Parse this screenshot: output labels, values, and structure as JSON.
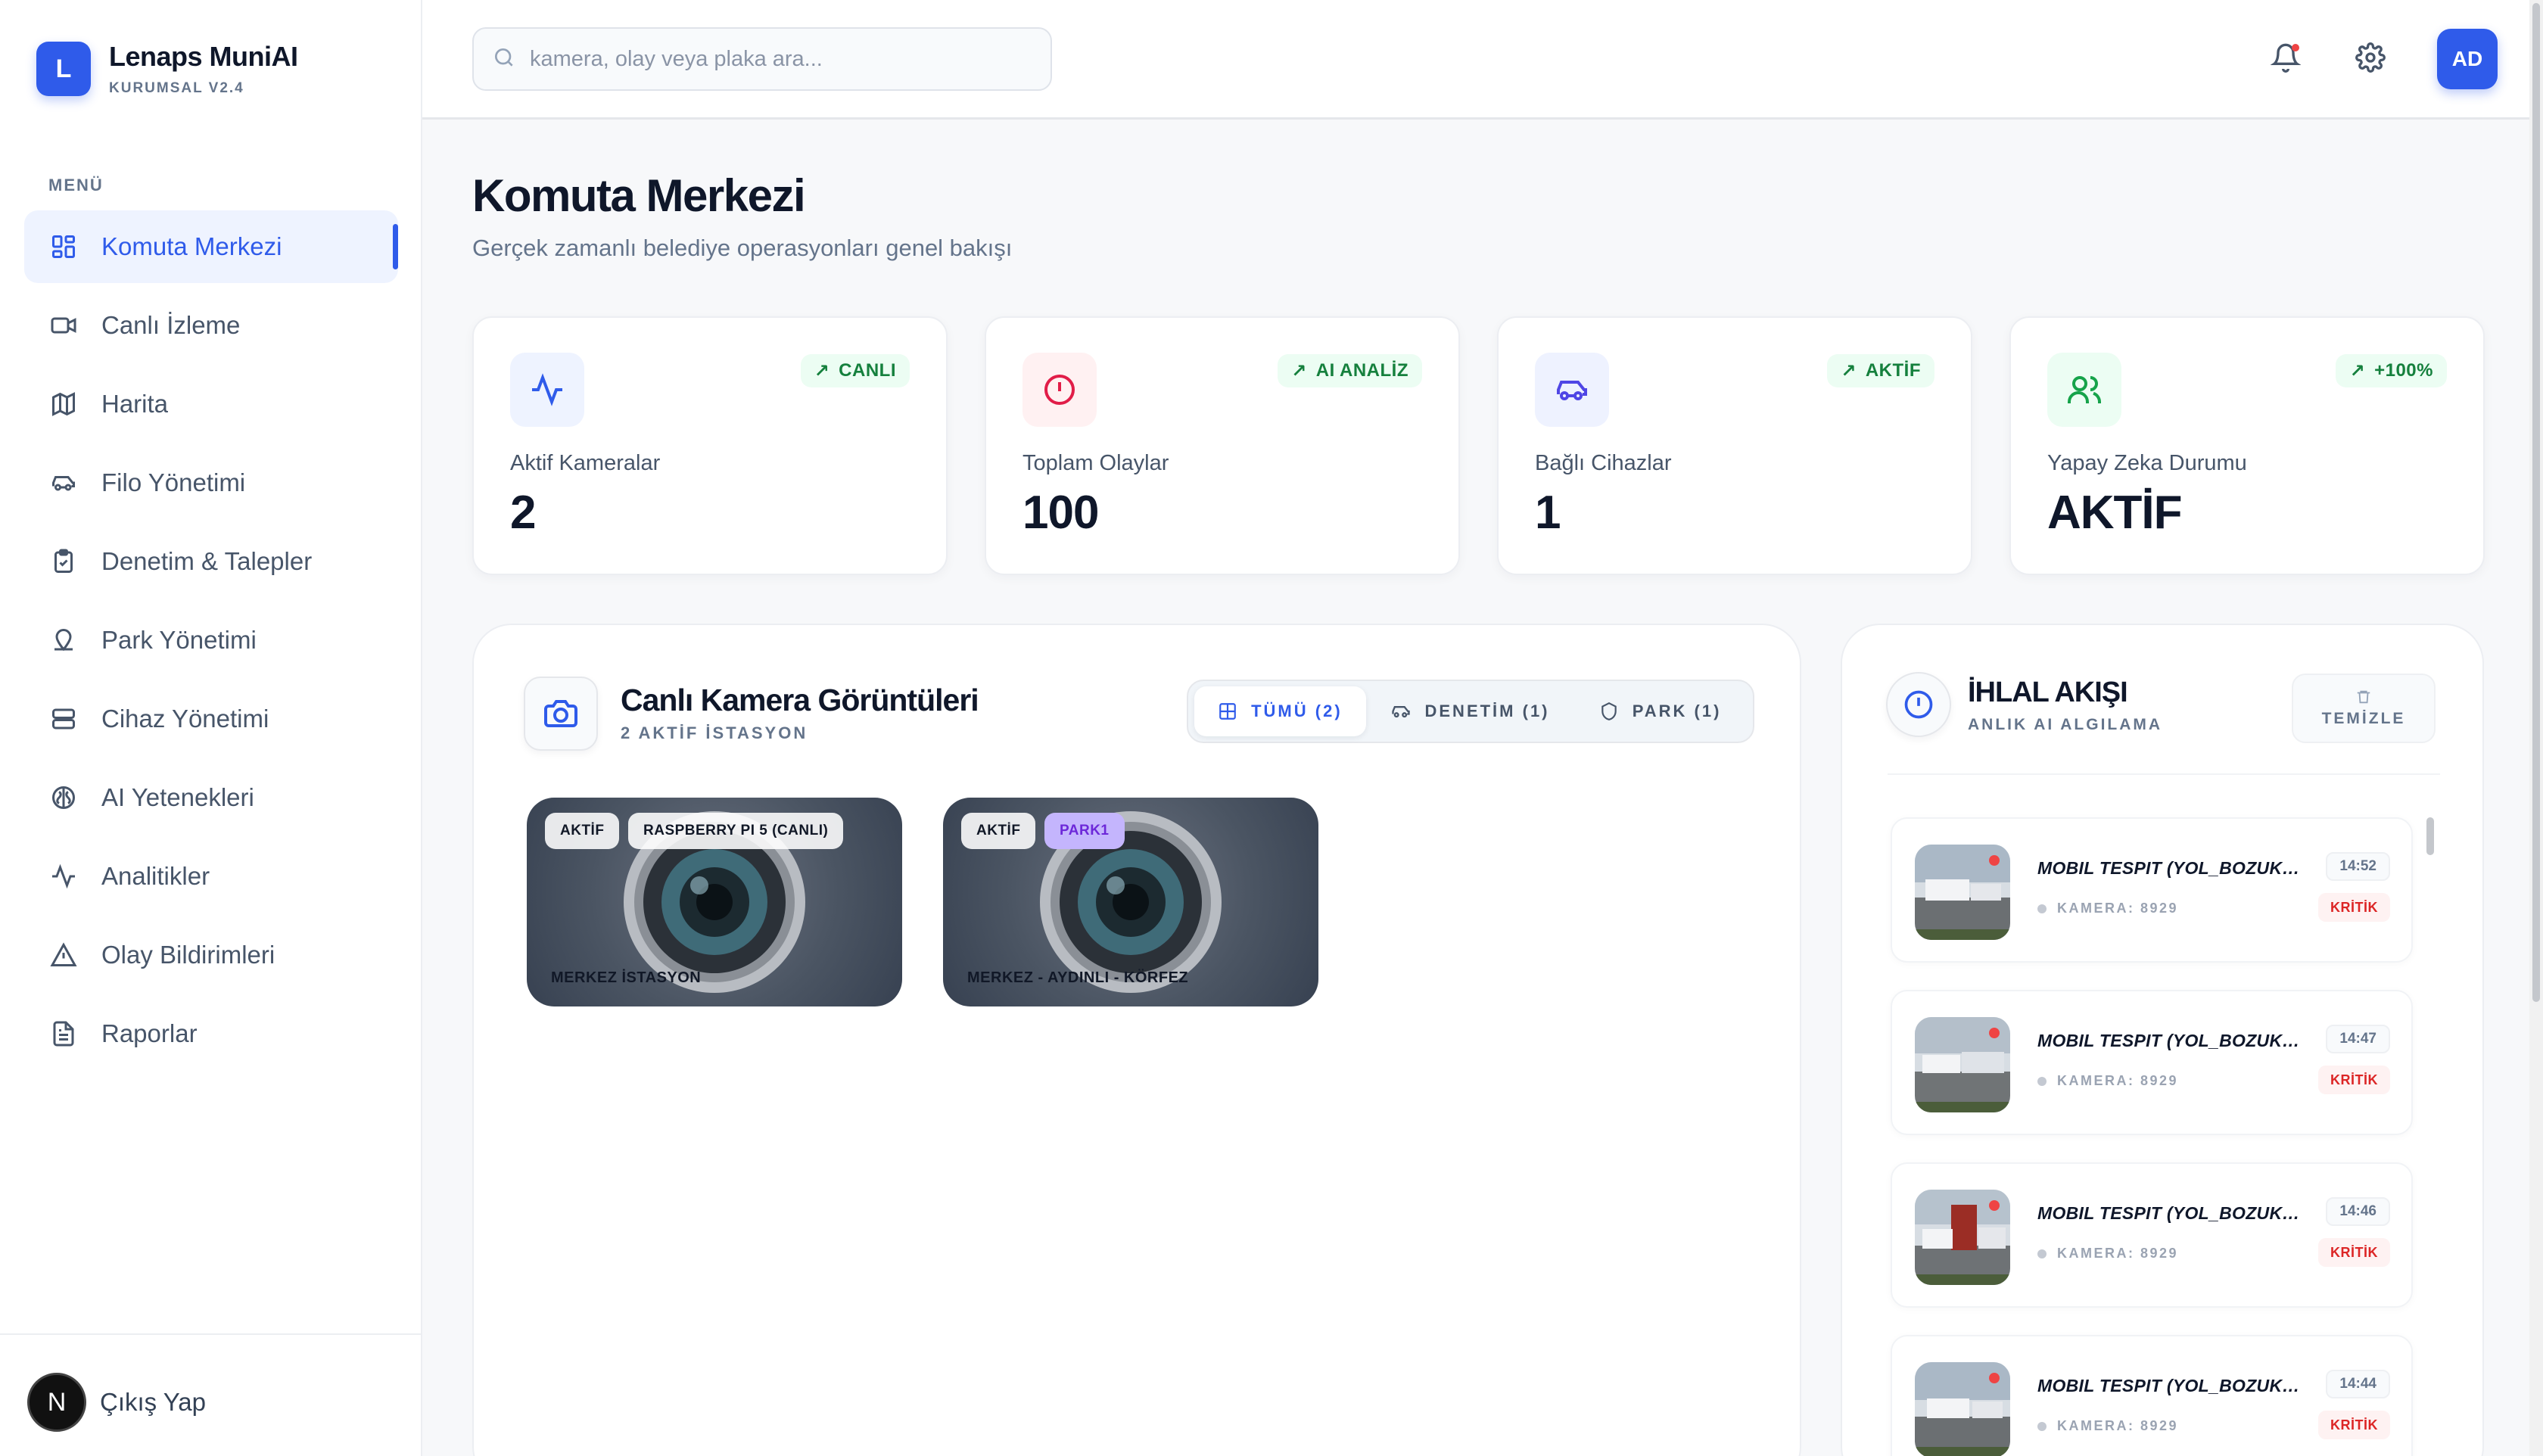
{
  "brand": {
    "logo_letter": "L",
    "name": "Lenaps MuniAI",
    "subtitle": "KURUMSAL V2.4",
    "accent_color": "#2f5bea"
  },
  "sidebar": {
    "menu_heading": "MENÜ",
    "items": [
      {
        "label": "Komuta Merkezi",
        "icon": "dashboard-grid-icon",
        "active": true
      },
      {
        "label": "Canlı İzleme",
        "icon": "video-camera-icon"
      },
      {
        "label": "Harita",
        "icon": "map-icon"
      },
      {
        "label": "Filo Yönetimi",
        "icon": "car-icon"
      },
      {
        "label": "Denetim & Talepler",
        "icon": "clipboard-check-icon"
      },
      {
        "label": "Park Yönetimi",
        "icon": "parking-icon"
      },
      {
        "label": "Cihaz Yönetimi",
        "icon": "server-icon"
      },
      {
        "label": "AI Yetenekleri",
        "icon": "brain-icon"
      },
      {
        "label": "Analitikler",
        "icon": "activity-icon"
      },
      {
        "label": "Olay Bildirimleri",
        "icon": "alert-triangle-icon"
      },
      {
        "label": "Raporlar",
        "icon": "file-text-icon"
      }
    ],
    "logout": {
      "avatar_letter": "N",
      "label": "Çıkış Yap"
    }
  },
  "topbar": {
    "search_placeholder": "kamera, olay veya plaka ara...",
    "user_initials": "AD",
    "has_notification": true
  },
  "header": {
    "title": "Komuta Merkezi",
    "subtitle": "Gerçek zamanlı belediye operasyonları genel bakışı"
  },
  "stats": [
    {
      "label": "Aktif Kameralar",
      "value": "2",
      "badge": "CANLI",
      "icon": "activity-icon",
      "icon_color": "#2f5bea",
      "icon_bg": "#eef3ff"
    },
    {
      "label": "Toplam Olaylar",
      "value": "100",
      "badge": "AI ANALİZ",
      "icon": "alert-circle-icon",
      "icon_color": "#e11d48",
      "icon_bg": "#fff1f2"
    },
    {
      "label": "Bağlı Cihazlar",
      "value": "1",
      "badge": "AKTİF",
      "icon": "car-icon",
      "icon_color": "#4f46e5",
      "icon_bg": "#eef2ff"
    },
    {
      "label": "Yapay Zeka Durumu",
      "value": "AKTİF",
      "badge": "+100%",
      "icon": "users-icon",
      "icon_color": "#16a34a",
      "icon_bg": "#ecfdf3"
    }
  ],
  "cameras": {
    "title": "Canlı Kamera Görüntüleri",
    "subtitle": "2 AKTİF İSTASYON",
    "filters": [
      {
        "label": "TÜMÜ (2)",
        "icon": "grid-icon",
        "active": true
      },
      {
        "label": "DENETİM (1)",
        "icon": "car-icon"
      },
      {
        "label": "PARK (1)",
        "icon": "shield-icon"
      }
    ],
    "feeds": [
      {
        "status": "AKTİF",
        "tag": "RASPBERRY PI 5 (CANLI)",
        "tag_style": "light",
        "name": "MERKEZ İSTASYON"
      },
      {
        "status": "AKTİF",
        "tag": "PARK1",
        "tag_style": "purple",
        "name": "MERKEZ - AYDINLI - KÖRFEZ"
      }
    ]
  },
  "violations": {
    "title": "İHLAL AKIŞI",
    "subtitle": "ANLIK AI ALGILAMA",
    "clear_label": "TEMİZLE",
    "items": [
      {
        "title": "MOBIL TESPIT (YOL_BOZUKL...",
        "camera": "KAMERA: 8929",
        "time": "14:52",
        "severity": "KRİTİK"
      },
      {
        "title": "MOBIL TESPIT (YOL_BOZUKL...",
        "camera": "KAMERA: 8929",
        "time": "14:47",
        "severity": "KRİTİK"
      },
      {
        "title": "MOBIL TESPIT (YOL_BOZUKL...",
        "camera": "KAMERA: 8929",
        "time": "14:46",
        "severity": "KRİTİK"
      },
      {
        "title": "MOBIL TESPIT (YOL_BOZUKL...",
        "camera": "KAMERA: 8929",
        "time": "14:44",
        "severity": "KRİTİK"
      }
    ]
  }
}
